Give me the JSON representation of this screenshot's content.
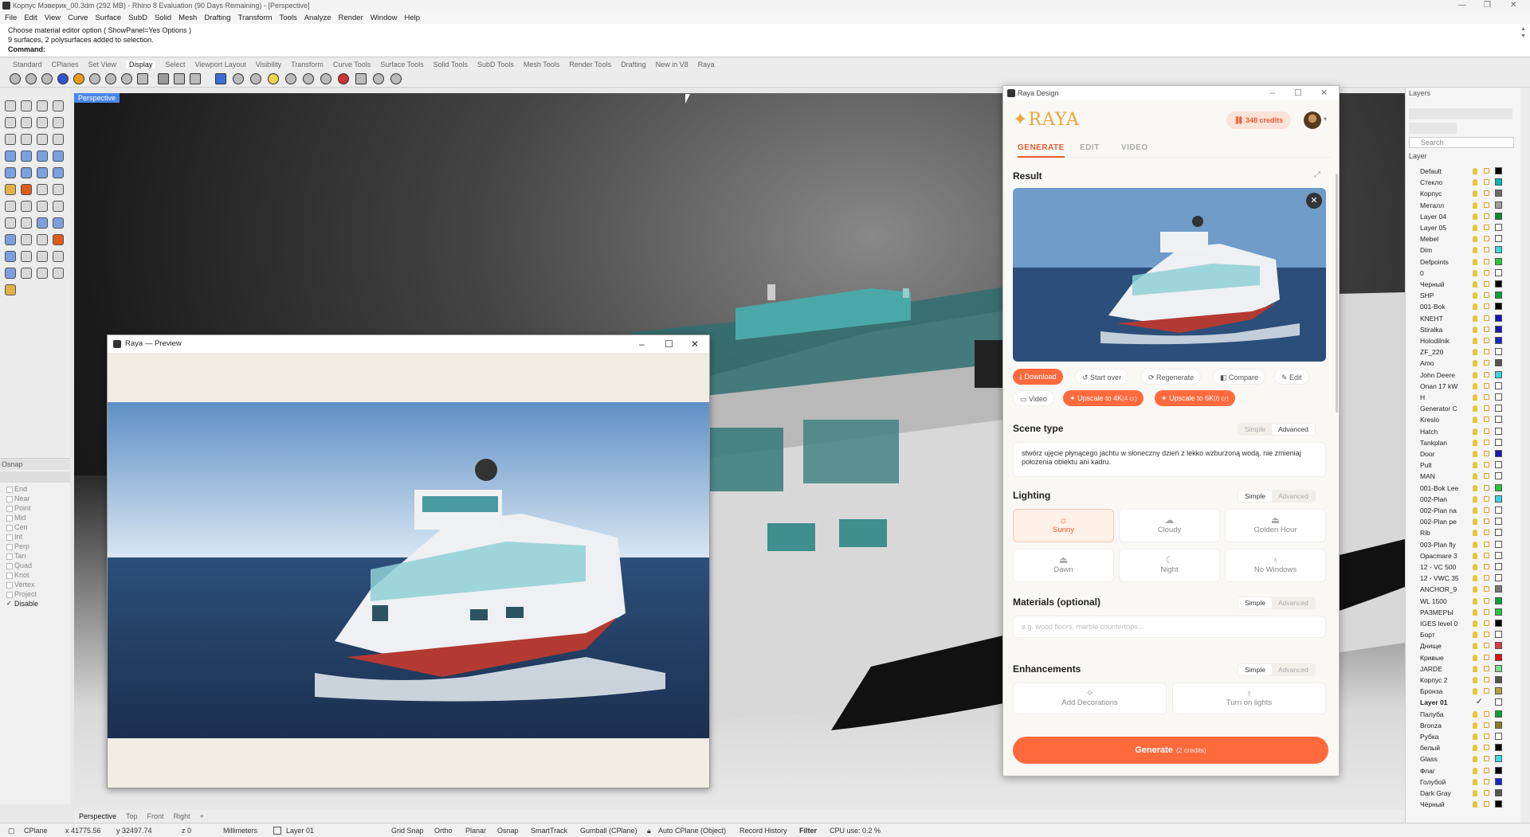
{
  "window": {
    "title": "Корпус Мэверик_00.3dm (292 MB) - Rhino 8 Evaluation (90 Days Remaining) - [Perspective]"
  },
  "menu": [
    "File",
    "Edit",
    "View",
    "Curve",
    "Surface",
    "SubD",
    "Solid",
    "Mesh",
    "Drafting",
    "Transform",
    "Tools",
    "Analyze",
    "Render",
    "Window",
    "Help"
  ],
  "command_history": [
    "Choose material editor option ( ShowPanel=Yes  Options )",
    "9 surfaces, 2 polysurfaces added to selection."
  ],
  "command_prompt": "Command:",
  "toolbar_tabs": [
    {
      "label": "Standard",
      "active": false
    },
    {
      "label": "CPlanes",
      "active": false
    },
    {
      "label": "Set View",
      "active": false
    },
    {
      "label": "Display",
      "active": true
    },
    {
      "label": "Select",
      "active": false
    },
    {
      "label": "Viewport Layout",
      "active": false
    },
    {
      "label": "Visibility",
      "active": false
    },
    {
      "label": "Transform",
      "active": false
    },
    {
      "label": "Curve Tools",
      "active": false
    },
    {
      "label": "Surface Tools",
      "active": false
    },
    {
      "label": "Solid Tools",
      "active": false
    },
    {
      "label": "SubD Tools",
      "active": false
    },
    {
      "label": "Mesh Tools",
      "active": false
    },
    {
      "label": "Render Tools",
      "active": false
    },
    {
      "label": "Drafting",
      "active": false
    },
    {
      "label": "New in V8",
      "active": false
    },
    {
      "label": "Raya",
      "active": false
    }
  ],
  "viewport": {
    "label": "Perspective",
    "tabs": [
      "Perspective",
      "Top",
      "Front",
      "Right"
    ]
  },
  "osnap": {
    "title": "Osnap",
    "items": [
      {
        "label": "End",
        "checked": false
      },
      {
        "label": "Near",
        "checked": false
      },
      {
        "label": "Point",
        "checked": false
      },
      {
        "label": "Mid",
        "checked": false
      },
      {
        "label": "Cen",
        "checked": false
      },
      {
        "label": "Int",
        "checked": false
      },
      {
        "label": "Perp",
        "checked": false
      },
      {
        "label": "Tan",
        "checked": false
      },
      {
        "label": "Quad",
        "checked": false
      },
      {
        "label": "Knot",
        "checked": false
      },
      {
        "label": "Vertex",
        "checked": false
      },
      {
        "label": "Project",
        "checked": false
      },
      {
        "label": "Disable",
        "checked": true
      }
    ]
  },
  "preview": {
    "title": "Raya — Preview"
  },
  "raya": {
    "window_title": "Raya Design",
    "logo": "RAYA",
    "credits": "348 credits",
    "tabs": [
      "GENERATE",
      "EDIT",
      "VIDEO"
    ],
    "result_title": "Result",
    "actions": {
      "download": "Download",
      "start_over": "Start over",
      "regenerate": "Regenerate",
      "compare": "Compare",
      "edit": "Edit",
      "video": "Video",
      "upscale_4k": "Upscale to 4K",
      "upscale_4k_cost": "(4 cr)",
      "upscale_6k": "Upscale to 6K",
      "upscale_6k_cost": "(6 cr)"
    },
    "scene": {
      "title": "Scene type",
      "mode_simple": "Simple",
      "mode_advanced": "Advanced",
      "prompt": "stwórz ujęcie płynącego jachtu w słoneczny dzień z lekko wzburzoną wodą. nie zmieniaj położenia obiektu ani kadru."
    },
    "lighting": {
      "title": "Lighting",
      "mode_simple": "Simple",
      "mode_advanced": "Advanced",
      "options": [
        {
          "label": "Sunny",
          "icon": "sun-icon",
          "selected": true
        },
        {
          "label": "Cloudy",
          "icon": "cloud-icon",
          "selected": false
        },
        {
          "label": "Golden Hour",
          "icon": "sunset-icon",
          "selected": false
        },
        {
          "label": "Dawn",
          "icon": "sunrise-icon",
          "selected": false
        },
        {
          "label": "Night",
          "icon": "moon-icon",
          "selected": false
        },
        {
          "label": "No Windows",
          "icon": "bulb-icon",
          "selected": false
        }
      ]
    },
    "materials": {
      "title": "Materials (optional)",
      "mode_simple": "Simple",
      "mode_advanced": "Advanced",
      "placeholder": "e.g. wood floors, marble countertops..."
    },
    "enhancements": {
      "title": "Enhancements",
      "mode_simple": "Simple",
      "mode_advanced": "Advanced",
      "options": [
        {
          "label": "Add Decorations",
          "icon": "wand-icon"
        },
        {
          "label": "Turn on lights",
          "icon": "bulb-icon"
        }
      ]
    },
    "generate": {
      "label": "Generate",
      "cost": "(2 credits)"
    }
  },
  "layers": {
    "title": "Layers",
    "search_placeholder": "Search",
    "column": "Layer",
    "rows": [
      {
        "name": "Default",
        "color": "#000000"
      },
      {
        "name": "Стекло",
        "color": "#00b8b8"
      },
      {
        "name": "Корпус",
        "color": "#6d6d6d"
      },
      {
        "name": "Металл",
        "color": "#a0a0a0"
      },
      {
        "name": "Layer 04",
        "color": "#0a8a2a"
      },
      {
        "name": "Layer 05",
        "color": "#ffffff"
      },
      {
        "name": "Mebel",
        "color": "#ffffff"
      },
      {
        "name": "Dim",
        "color": "#3fd3e0"
      },
      {
        "name": "Defpoints",
        "color": "#29c43f"
      },
      {
        "name": "0",
        "color": "#ffffff"
      },
      {
        "name": "Черный",
        "color": "#000000"
      },
      {
        "name": "SHP",
        "color": "#0ea03a"
      },
      {
        "name": "001-Bok",
        "color": "#000000"
      },
      {
        "name": "KNEHT",
        "color": "#1414c8"
      },
      {
        "name": "Stiralka",
        "color": "#1a1ab0"
      },
      {
        "name": "Holodilnik",
        "color": "#1428c8"
      },
      {
        "name": "ZF_220",
        "color": "#ffffff"
      },
      {
        "name": "Amo",
        "color": "#555555"
      },
      {
        "name": "John Deere",
        "color": "#3fd3e0"
      },
      {
        "name": "Onan 17 kW",
        "color": "#ffffff"
      },
      {
        "name": "H",
        "color": "#ffffff"
      },
      {
        "name": "Generator C",
        "color": "#ffffff"
      },
      {
        "name": "Kreslo",
        "color": "#ffffff"
      },
      {
        "name": "Hatch",
        "color": "#ffffff"
      },
      {
        "name": "Tankplan",
        "color": "#ffffff"
      },
      {
        "name": "Door",
        "color": "#1a1ab0"
      },
      {
        "name": "Pult",
        "color": "#ffffff"
      },
      {
        "name": "MAN",
        "color": "#ffffff"
      },
      {
        "name": "001-Bok Lee",
        "color": "#29c43f"
      },
      {
        "name": "002-Plan",
        "color": "#3fd3e0"
      },
      {
        "name": "002-Plan na",
        "color": "#ffffff"
      },
      {
        "name": "002-Plan pe",
        "color": "#ffffff"
      },
      {
        "name": "Rib",
        "color": "#ffffff"
      },
      {
        "name": "003-Plan fly",
        "color": "#ffffff"
      },
      {
        "name": "Opacmare 3",
        "color": "#ffffff"
      },
      {
        "name": "12 - VC 500",
        "color": "#ffffff"
      },
      {
        "name": "12 - VWC 35",
        "color": "#ffffff"
      },
      {
        "name": "ANCHOR_9",
        "color": "#777777"
      },
      {
        "name": "WL 1500",
        "color": "#0ea03a"
      },
      {
        "name": "РАЗМЕРЫ",
        "color": "#29c43f"
      },
      {
        "name": "IGES level 0",
        "color": "#000000"
      },
      {
        "name": "Борт",
        "color": "#ffffff"
      },
      {
        "name": "Днище",
        "color": "#d44040"
      },
      {
        "name": "Кривые",
        "color": "#e01010"
      },
      {
        "name": "JARDE",
        "color": "#7ddc8a"
      },
      {
        "name": "Корпус 2",
        "color": "#555555"
      },
      {
        "name": "Бронза",
        "color": "#b8a040"
      },
      {
        "name": "Layer 01",
        "color": "#ffffff",
        "current": true
      },
      {
        "name": "Палуба",
        "color": "#0ea03a"
      },
      {
        "name": "Bronza",
        "color": "#8a7a2a"
      },
      {
        "name": "Рубка",
        "color": "#ffffff"
      },
      {
        "name": "белый",
        "color": "#000000"
      },
      {
        "name": "Glass",
        "color": "#3fd3e0"
      },
      {
        "name": "Флаг",
        "color": "#000000"
      },
      {
        "name": "Голубой",
        "color": "#1428c8"
      },
      {
        "name": "Dark Gray",
        "color": "#555555"
      },
      {
        "name": "Чёрный",
        "color": "#000000"
      }
    ]
  },
  "status": {
    "cplane": "CPlane",
    "x": "x 41775.56",
    "y": "y 32497.74",
    "z": "z 0",
    "units": "Millimeters",
    "layer": "Layer 01",
    "toggles": [
      "Grid Snap",
      "Ortho",
      "Planar",
      "Osnap",
      "SmartTrack",
      "Gumball (CPlane)",
      "Auto CPlane (Object)",
      "Record History",
      "Filter"
    ],
    "cpu": "CPU use: 0.2 %"
  }
}
